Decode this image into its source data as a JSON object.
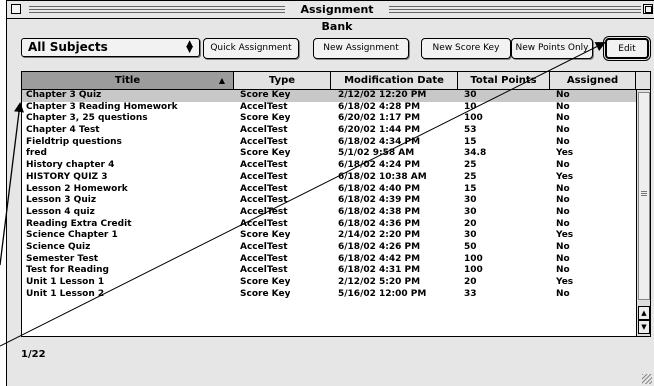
{
  "window": {
    "title": "Assignment Bank"
  },
  "toolbar": {
    "subject_select": "All Subjects",
    "buttons": [
      "Quick Assignment",
      "New Assignment",
      "New Score Key",
      "New Points Only",
      "Edit"
    ]
  },
  "table": {
    "columns": [
      "Title",
      "Type",
      "Modification Date",
      "Total Points",
      "Assigned"
    ],
    "rows": [
      [
        "Chapter 3 Quiz",
        "Score Key",
        "2/12/02 12:20 PM",
        "30",
        "No"
      ],
      [
        "Chapter 3 Reading Homework",
        "AccelTest",
        "6/18/02 4:28 PM",
        "10",
        "No"
      ],
      [
        "Chapter 3, 25 questions",
        "Score Key",
        "6/20/02 1:17 PM",
        "100",
        "No"
      ],
      [
        "Chapter 4 Test",
        "AccelTest",
        "6/20/02 1:44 PM",
        "53",
        "No"
      ],
      [
        "Fieldtrip questions",
        "AccelTest",
        "6/18/02 4:34 PM",
        "15",
        "No"
      ],
      [
        "fred",
        "Score Key",
        "5/1/02 9:58 AM",
        "34.8",
        "Yes"
      ],
      [
        "History chapter 4",
        "AccelTest",
        "6/18/02 4:24 PM",
        "25",
        "No"
      ],
      [
        "HISTORY QUIZ 3",
        "AccelTest",
        "6/18/02 10:38 AM",
        "25",
        "Yes"
      ],
      [
        "Lesson 2 Homework",
        "AccelTest",
        "6/18/02 4:40 PM",
        "15",
        "No"
      ],
      [
        "Lesson 3 Quiz",
        "AccelTest",
        "6/18/02 4:39 PM",
        "30",
        "No"
      ],
      [
        "Lesson 4 quiz",
        "AccelTest",
        "6/18/02 4:38 PM",
        "30",
        "No"
      ],
      [
        "Reading Extra Credit",
        "AccelTest",
        "6/18/02 4:36 PM",
        "20",
        "No"
      ],
      [
        "Science Chapter 1",
        "Score Key",
        "2/14/02 2:20 PM",
        "30",
        "Yes"
      ],
      [
        "Science Quiz",
        "AccelTest",
        "6/18/02 4:26 PM",
        "50",
        "No"
      ],
      [
        "Semester Test",
        "AccelTest",
        "6/18/02 4:42 PM",
        "100",
        "No"
      ],
      [
        "Test for Reading",
        "AccelTest",
        "6/18/02 4:31 PM",
        "100",
        "No"
      ],
      [
        "Unit 1 Lesson 1",
        "Score Key",
        "2/12/02 5:20 PM",
        "20",
        "Yes"
      ],
      [
        "Unit 1 Lesson 2",
        "Score Key",
        "5/16/02 12:00 PM",
        "33",
        "No"
      ]
    ]
  },
  "status": {
    "record_count": "1/22"
  }
}
